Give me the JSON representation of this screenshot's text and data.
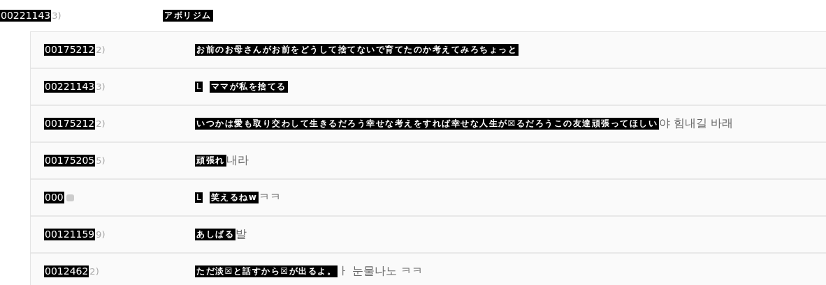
{
  "header": {
    "id": "00221143",
    "suffix": "3)",
    "translation": "アボリジム"
  },
  "replies": [
    {
      "id": "00175212",
      "suffix": "2)",
      "badge": false,
      "reply_mark": false,
      "translation": "お前のお母さんがお前をどうして捨てないで育てたのか考えてみろちょっと"
    },
    {
      "id": "00221143",
      "suffix": "3)",
      "badge": false,
      "reply_mark": true,
      "mark_text": "L",
      "translation": "ママが私を捨てる"
    },
    {
      "id": "00175212",
      "suffix": "2)",
      "badge": false,
      "reply_mark": false,
      "translation": "いつかは愛も取り交わして生きるだろう幸せな考えをすれば幸せな人生が☒るだろうこの友達頑張ってほしい",
      "remainder": "야 힘내길 바래"
    },
    {
      "id": "00175205",
      "suffix": "5)",
      "badge": false,
      "reply_mark": false,
      "translation": "頑張れ",
      "remainder": "내라"
    },
    {
      "id": "000",
      "badge": true,
      "reply_mark": true,
      "mark_text": "L",
      "translation": "笑えるねw",
      "remainder": "ㅋㅋ"
    },
    {
      "id": "00121159",
      "suffix": "9)",
      "badge": false,
      "reply_mark": false,
      "translation": "あしばる",
      "remainder": "발"
    },
    {
      "id": "0012462",
      "suffix": "2)",
      "badge": false,
      "reply_mark": false,
      "translation": "ただ淡☒と話すから☒が出るよ。",
      "remainder": "ㅏ 눈물나노 ㅋㅋ"
    }
  ]
}
